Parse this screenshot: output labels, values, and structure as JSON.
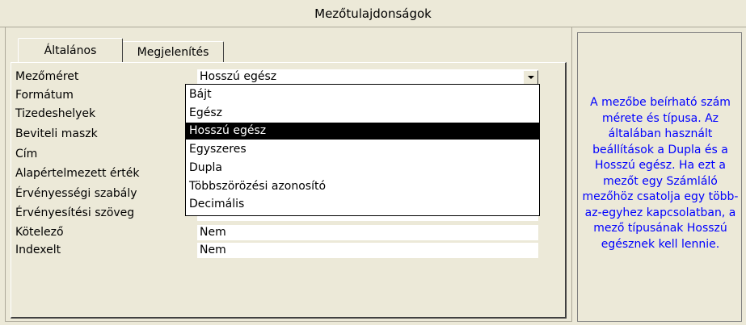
{
  "window": {
    "title": "Mezőtulajdonságok"
  },
  "tabs": [
    {
      "label": "Általános",
      "active": true
    },
    {
      "label": "Megjelenítés",
      "active": false
    }
  ],
  "properties": [
    {
      "label": "Mezőméret",
      "value": "Hosszú egész"
    },
    {
      "label": "Formátum",
      "value": ""
    },
    {
      "label": "Tizedeshelyek",
      "value": ""
    },
    {
      "label": "Beviteli maszk",
      "value": ""
    },
    {
      "label": "Cím",
      "value": ""
    },
    {
      "label": "Alapértelmezett érték",
      "value": ""
    },
    {
      "label": "Érvényességi szabály",
      "value": ""
    },
    {
      "label": "Érvényesítési szöveg",
      "value": ""
    },
    {
      "label": "Kötelező",
      "value": "Nem"
    },
    {
      "label": "Indexelt",
      "value": "Nem"
    }
  ],
  "dropdown": {
    "icon": "triangle-down-icon",
    "selected_index": 2,
    "options": [
      "Bájt",
      "Egész",
      "Hosszú egész",
      "Egyszeres",
      "Dupla",
      "Többszörözési azonosító",
      "Decimális"
    ]
  },
  "help": {
    "text": "A mezőbe beírható szám mérete és típusa. Az általában használt beállítások a Dupla és a Hosszú egész. Ha ezt a mezőt egy Számláló mezőhöz csatolja egy több-az-egyhez kapcsolatban, a mező típusának Hosszú egésznek kell lennie.",
    "color": "#0000ff"
  }
}
